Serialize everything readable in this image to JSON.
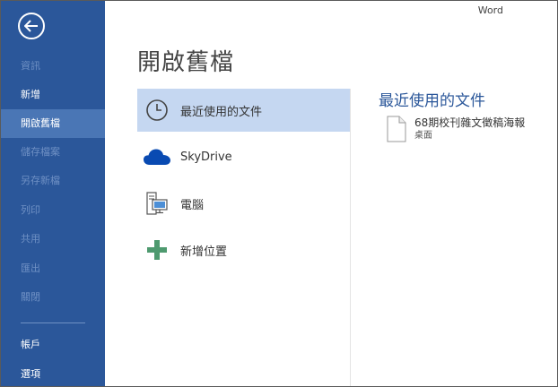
{
  "app_name": "Word",
  "page_title": "開啟舊檔",
  "sidebar": {
    "items": [
      {
        "label": "資訊",
        "state": "disabled"
      },
      {
        "label": "新增",
        "state": "enabled"
      },
      {
        "label": "開啟舊檔",
        "state": "selected"
      },
      {
        "label": "儲存檔案",
        "state": "disabled"
      },
      {
        "label": "另存新檔",
        "state": "disabled"
      },
      {
        "label": "列印",
        "state": "disabled"
      },
      {
        "label": "共用",
        "state": "disabled"
      },
      {
        "label": "匯出",
        "state": "disabled"
      },
      {
        "label": "關閉",
        "state": "disabled"
      },
      {
        "label": "帳戶",
        "state": "enabled"
      },
      {
        "label": "選項",
        "state": "enabled"
      }
    ]
  },
  "places": [
    {
      "label": "最近使用的文件",
      "icon": "clock-icon",
      "selected": true
    },
    {
      "label": "SkyDrive",
      "icon": "cloud-icon",
      "selected": false
    },
    {
      "label": "電腦",
      "icon": "computer-icon",
      "selected": false
    },
    {
      "label": "新增位置",
      "icon": "plus-icon",
      "selected": false
    }
  ],
  "recent": {
    "title": "最近使用的文件",
    "files": [
      {
        "name": "68期校刊雜文徵稿海報",
        "location": "桌面",
        "icon": "document-icon"
      }
    ]
  },
  "colors": {
    "sidebar_bg": "#2b579a",
    "sidebar_selected": "#4a76b5",
    "place_selected": "#c5d7f1",
    "accent_text": "#2b579a"
  }
}
